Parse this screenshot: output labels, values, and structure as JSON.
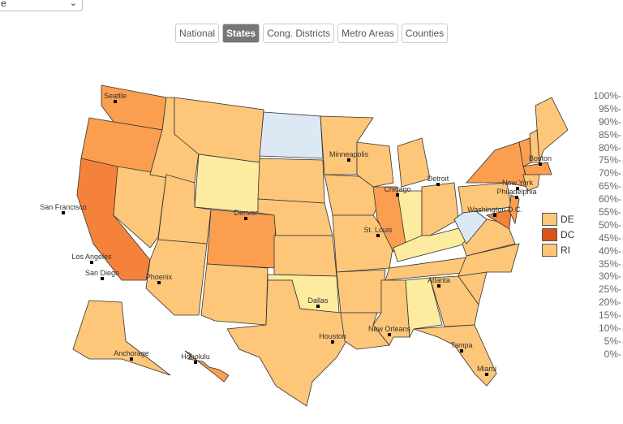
{
  "select": {
    "value": "e"
  },
  "tabs": [
    {
      "label": "National",
      "active": false
    },
    {
      "label": "States",
      "active": true
    },
    {
      "label": "Cong. Districts",
      "active": false
    },
    {
      "label": "Metro Areas",
      "active": false
    },
    {
      "label": "Counties",
      "active": false
    }
  ],
  "colors": {
    "light_blue": "#dce9f5",
    "pale": "#fdeb9f",
    "mid": "#fdc678",
    "orange": "#fb9e4f",
    "dark": "#f5823a",
    "dc": "#d95319"
  },
  "states": {
    "WA": "orange",
    "OR": "orange",
    "CA": "dark",
    "NV": "mid",
    "ID": "mid",
    "MT": "mid",
    "WY": "pale",
    "UT": "mid",
    "AZ": "mid",
    "CO": "orange",
    "NM": "mid",
    "ND": "light_blue",
    "SD": "mid",
    "NE": "mid",
    "KS": "mid",
    "OK": "pale",
    "TX": "mid",
    "MN": "mid",
    "IA": "mid",
    "MO": "mid",
    "AR": "mid",
    "LA": "mid",
    "WI": "mid",
    "IL": "orange",
    "MI": "mid",
    "IN": "pale",
    "OH": "mid",
    "KY": "pale",
    "TN": "mid",
    "MS": "mid",
    "AL": "pale",
    "GA": "mid",
    "FL": "mid",
    "SC": "mid",
    "NC": "mid",
    "VA": "mid",
    "WV": "light_blue",
    "PA": "mid",
    "NY": "orange",
    "MD": "dark",
    "NJ": "orange",
    "VT": "orange",
    "NH": "mid",
    "ME": "mid",
    "MA": "orange",
    "CT": "mid",
    "AK": "mid",
    "HI": "orange"
  },
  "cities": [
    "Seattle",
    "San Francisco",
    "Los Angeles",
    "San Diego",
    "Phoenix",
    "Denver",
    "Minneapolis",
    "Chicago",
    "Detroit",
    "St. Louis",
    "Dallas",
    "Houston",
    "New Orleans",
    "Atlanta",
    "Tampa",
    "Miami",
    "Washington D.C.",
    "Philadelphia",
    "New York",
    "Boston",
    "Anchorage",
    "Honolulu"
  ],
  "legend": [
    {
      "label": "DE",
      "color": "mid"
    },
    {
      "label": "DC",
      "color": "dc"
    },
    {
      "label": "RI",
      "color": "mid"
    }
  ],
  "scale": [
    "100%",
    "95%",
    "90%",
    "85%",
    "80%",
    "75%",
    "70%",
    "65%",
    "60%",
    "55%",
    "50%",
    "45%",
    "40%",
    "35%",
    "30%",
    "25%",
    "20%",
    "15%",
    "10%",
    "5%",
    "0%"
  ]
}
